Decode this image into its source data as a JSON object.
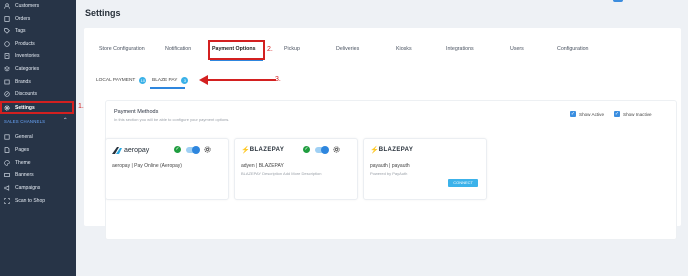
{
  "sidebar": {
    "items": [
      {
        "label": "Customers",
        "icon": "users-icon"
      },
      {
        "label": "Orders",
        "icon": "orders-icon"
      },
      {
        "label": "Tags",
        "icon": "tag-icon"
      },
      {
        "label": "Products",
        "icon": "box-icon"
      },
      {
        "label": "Inventories",
        "icon": "clipboard-icon"
      },
      {
        "label": "Categories",
        "icon": "layers-icon"
      },
      {
        "label": "Brands",
        "icon": "brand-icon"
      },
      {
        "label": "Discounts",
        "icon": "discount-icon"
      },
      {
        "label": "Settings",
        "icon": "gear-icon"
      }
    ],
    "section_label": "SALES CHANNELS",
    "channel_items": [
      {
        "label": "General",
        "icon": "general-icon"
      },
      {
        "label": "Pages",
        "icon": "page-icon"
      },
      {
        "label": "Theme",
        "icon": "theme-icon"
      },
      {
        "label": "Banners",
        "icon": "banner-icon"
      },
      {
        "label": "Campaigns",
        "icon": "campaign-icon"
      },
      {
        "label": "Scan to Shop",
        "icon": "scan-icon"
      }
    ]
  },
  "annotations": {
    "step1": "1.",
    "step2": "2.",
    "step3": "3."
  },
  "page": {
    "title": "Settings",
    "tabs": [
      {
        "label": "Store Configuration"
      },
      {
        "label": "Notification"
      },
      {
        "label": "Payment Options"
      },
      {
        "label": "Pickup"
      },
      {
        "label": "Deliveries"
      },
      {
        "label": "Kiosks"
      },
      {
        "label": "Integrations"
      },
      {
        "label": "Users"
      },
      {
        "label": "Configuration"
      }
    ],
    "subtabs": [
      {
        "label": "LOCAL PAYMENT",
        "count": "10"
      },
      {
        "label": "BLAZE PAY",
        "count": "3"
      }
    ],
    "payment_methods": {
      "title": "Payment Methods",
      "subtitle": "In this section you will be able to configure your payment options.",
      "show_active": "Show Active",
      "show_inactive": "Show Inactive",
      "providers": [
        {
          "name": "aeropay | Pay Online (Aeropay)",
          "description": "",
          "logo": "aeropay"
        },
        {
          "name": "adyen | BLAZEPAY",
          "description": "BLAZEPAY Description Add More Description",
          "logo": "BLAZEPAY"
        },
        {
          "name": "payauth | payauth",
          "description": "Powered by PayAuth",
          "logo": "BLAZEPAY",
          "button": "CONNECT"
        }
      ]
    }
  },
  "colors": {
    "sidebar": "#273447",
    "accent": "#2e86de",
    "annotation": "#d32020",
    "success": "#1f9d3f"
  }
}
